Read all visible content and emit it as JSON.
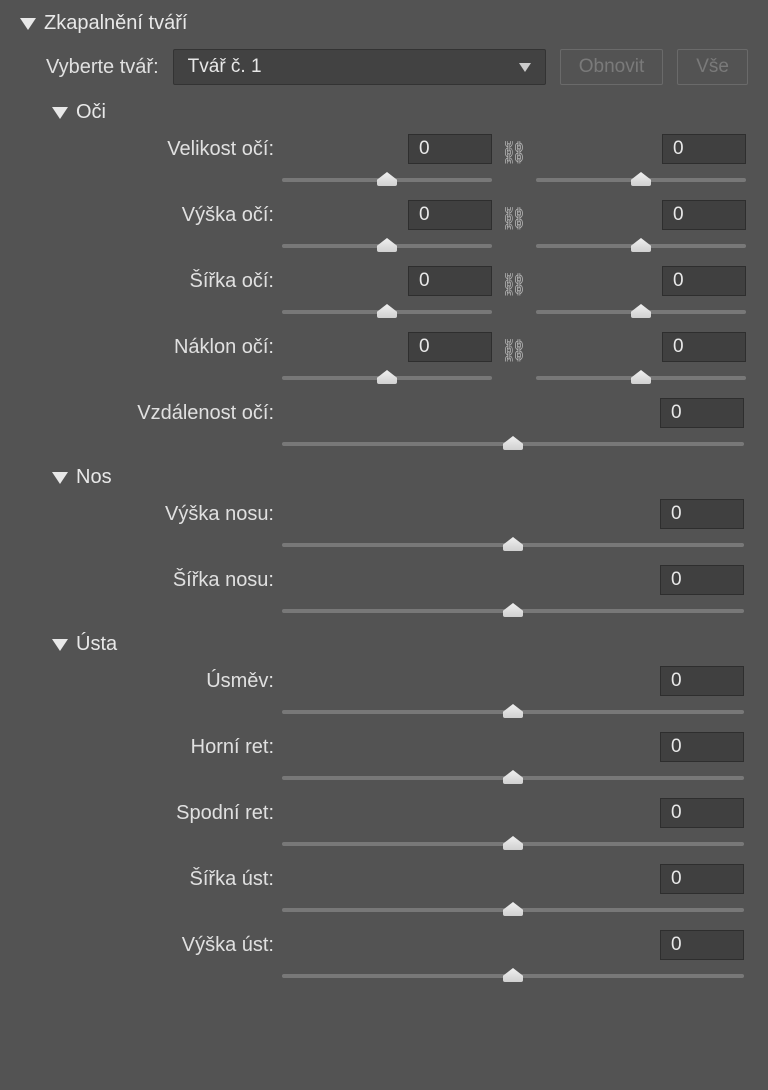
{
  "panel": {
    "title": "Zkapalnění tváří"
  },
  "faceSelect": {
    "label": "Vyberte tvář:",
    "value": "Tvář č. 1",
    "resetBtn": "Obnovit",
    "allBtn": "Vše"
  },
  "sections": {
    "eyes": {
      "title": "Oči",
      "rows": {
        "size": {
          "label": "Velikost očí:",
          "left": "0",
          "right": "0"
        },
        "height": {
          "label": "Výška očí:",
          "left": "0",
          "right": "0"
        },
        "width": {
          "label": "Šířka očí:",
          "left": "0",
          "right": "0"
        },
        "tilt": {
          "label": "Náklon očí:",
          "left": "0",
          "right": "0"
        },
        "distance": {
          "label": "Vzdálenost očí:",
          "value": "0"
        }
      }
    },
    "nose": {
      "title": "Nos",
      "rows": {
        "height": {
          "label": "Výška nosu:",
          "value": "0"
        },
        "width": {
          "label": "Šířka nosu:",
          "value": "0"
        }
      }
    },
    "mouth": {
      "title": "Ústa",
      "rows": {
        "smile": {
          "label": "Úsměv:",
          "value": "0"
        },
        "upperLip": {
          "label": "Horní ret:",
          "value": "0"
        },
        "lowerLip": {
          "label": "Spodní ret:",
          "value": "0"
        },
        "width": {
          "label": "Šířka úst:",
          "value": "0"
        },
        "height": {
          "label": "Výška úst:",
          "value": "0"
        }
      }
    }
  }
}
